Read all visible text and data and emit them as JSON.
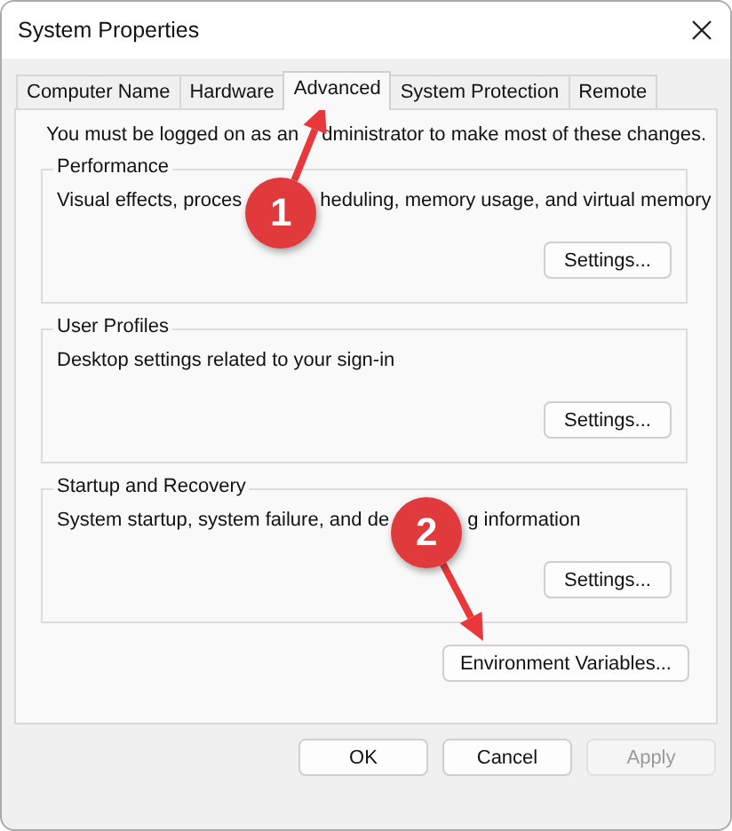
{
  "window": {
    "title": "System Properties"
  },
  "tabs": [
    {
      "label": "Computer Name",
      "selected": false
    },
    {
      "label": "Hardware",
      "selected": false
    },
    {
      "label": "Advanced",
      "selected": true
    },
    {
      "label": "System Protection",
      "selected": false
    },
    {
      "label": "Remote",
      "selected": false
    }
  ],
  "notice": [
    "You must be logged on as an",
    "dministrator to make most of these changes."
  ],
  "groups": [
    {
      "title": "Performance",
      "description": [
        "Visual effects, proces",
        "heduling, memory usage, and virtual memory"
      ],
      "button": "Settings..."
    },
    {
      "title": "User Profiles",
      "description": [
        "Desktop settings related to your sign-in"
      ],
      "button": "Settings..."
    },
    {
      "title": "Startup and Recovery",
      "description": [
        "System startup, system failure, and de",
        "g information"
      ],
      "button": "Settings..."
    }
  ],
  "environment_button": "Environment Variables...",
  "buttons": [
    {
      "label": "OK",
      "disabled": false
    },
    {
      "label": "Cancel",
      "disabled": false
    },
    {
      "label": "Apply",
      "disabled": true
    }
  ],
  "annotations": [
    {
      "number": "1"
    },
    {
      "number": "2"
    }
  ]
}
